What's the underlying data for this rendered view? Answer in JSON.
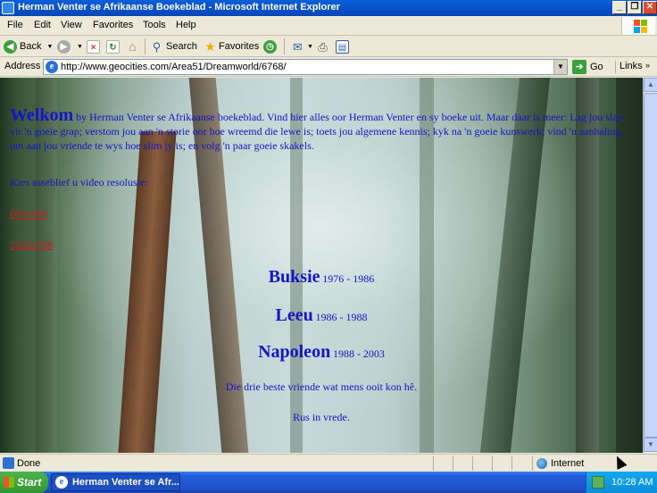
{
  "window": {
    "title": "Herman Venter se Afrikaanse Boekeblad - Microsoft Internet Explorer"
  },
  "menu": [
    "File",
    "Edit",
    "View",
    "Favorites",
    "Tools",
    "Help"
  ],
  "toolbar": {
    "back": "Back",
    "search": "Search",
    "favorites": "Favorites"
  },
  "address": {
    "label": "Address",
    "url": "http://www.geocities.com/Area51/Dreamworld/6768/",
    "go": "Go",
    "links": "Links"
  },
  "page": {
    "welkom": "Welkom",
    "intro": " by Herman Venter se Afrikaanse boekeblad. Vind hier alles oor Herman Venter en sy boeke uit. Maar daar is meer: Lag jou slap vir 'n goeie grap; verstom jou aan 'n storie oor hoe wreemd die lewe is; toets jou algemene kennis; kyk na 'n goeie kunswerk; vind 'n aanhaling om aan jou vriende te wys hoe slim jy is; en volg 'n paar goeie skakels.",
    "resolution_prompt": "Kies asseblief u video resolusie:",
    "res_links": [
      "800x600",
      "1024x768"
    ],
    "pets": [
      {
        "name": "Buksie",
        "years": "1976 - 1986"
      },
      {
        "name": "Leeu",
        "years": "1986 - 1988"
      },
      {
        "name": "Napoleon",
        "years": "1988 - 2003"
      }
    ],
    "tagline": "Die drie beste vriende wat mens ooit kon hê.",
    "rip": "Rus in vrede."
  },
  "status": {
    "text": "Done",
    "zone": "Internet"
  },
  "taskbar": {
    "start": "Start",
    "task": "Herman Venter se Afr...",
    "clock": "10:28 AM"
  },
  "colors": {
    "link_blue": "#1414C8",
    "visited_red": "#D01818",
    "xp_title": "#0A5FD8"
  }
}
